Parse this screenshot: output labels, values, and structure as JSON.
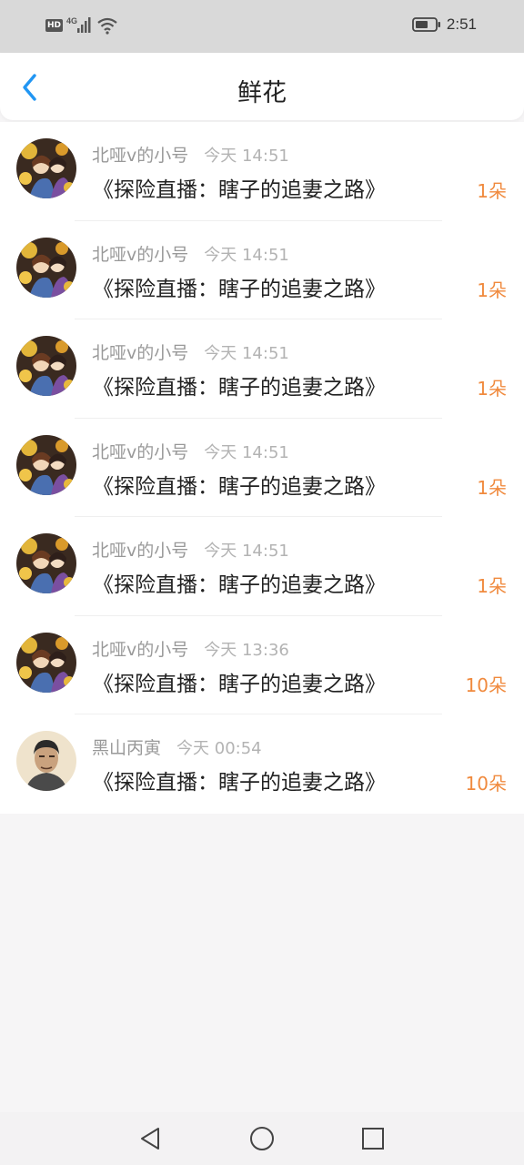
{
  "status_bar": {
    "network_hd": "HD",
    "network_4g": "4G",
    "time": "2:51",
    "icons": [
      "hd-icon",
      "signal-icon",
      "wifi-icon",
      "battery-icon"
    ]
  },
  "header": {
    "title": "鲜花",
    "back_icon": "chevron-left-icon",
    "accent_color": "#2196f3"
  },
  "rows": [
    {
      "user": "北哑v的小号",
      "time": "今天 14:51",
      "novel": "《探险直播：瞎子的追妻之路》",
      "amount": "1朵",
      "avatar": "anime"
    },
    {
      "user": "北哑v的小号",
      "time": "今天 14:51",
      "novel": "《探险直播：瞎子的追妻之路》",
      "amount": "1朵",
      "avatar": "anime"
    },
    {
      "user": "北哑v的小号",
      "time": "今天 14:51",
      "novel": "《探险直播：瞎子的追妻之路》",
      "amount": "1朵",
      "avatar": "anime"
    },
    {
      "user": "北哑v的小号",
      "time": "今天 14:51",
      "novel": "《探险直播：瞎子的追妻之路》",
      "amount": "1朵",
      "avatar": "anime"
    },
    {
      "user": "北哑v的小号",
      "time": "今天 14:51",
      "novel": "《探险直播：瞎子的追妻之路》",
      "amount": "1朵",
      "avatar": "anime"
    },
    {
      "user": "北哑v的小号",
      "time": "今天 13:36",
      "novel": "《探险直播：瞎子的追妻之路》",
      "amount": "10朵",
      "avatar": "anime"
    },
    {
      "user": "黑山丙寅",
      "time": "今天 00:54",
      "novel": "《探险直播：瞎子的追妻之路》",
      "amount": "10朵",
      "avatar": "portrait"
    }
  ],
  "colors": {
    "amount": "#f08a3e",
    "name": "#999999",
    "novel": "#222222"
  },
  "nav_bar": {
    "icons": [
      "back-triangle-icon",
      "home-circle-icon",
      "recents-square-icon"
    ]
  }
}
